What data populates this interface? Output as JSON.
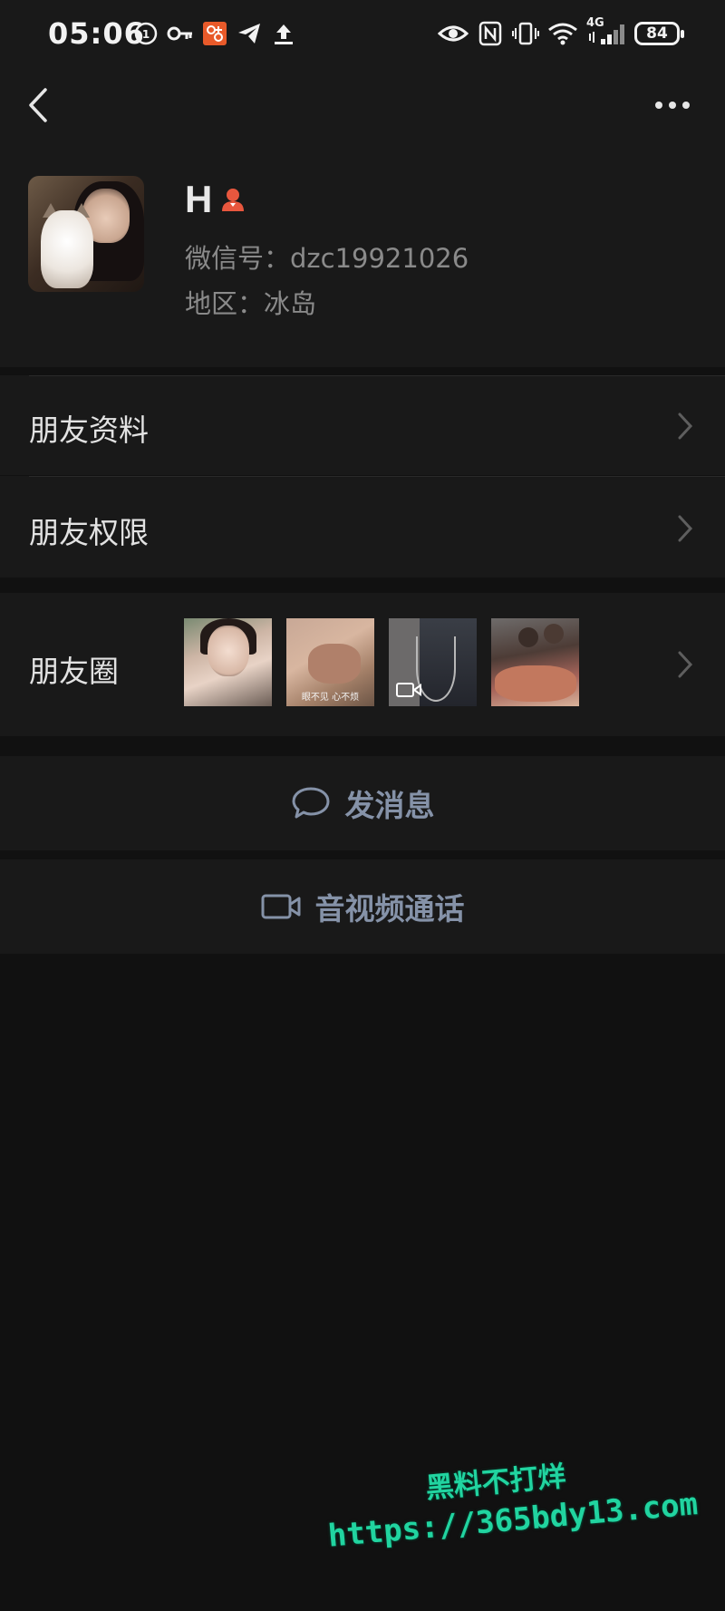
{
  "status_bar": {
    "time": "05:06",
    "network_label": "4G",
    "battery": "84"
  },
  "profile": {
    "name": "H",
    "wechat_id": "微信号：dzc19921026",
    "region": "地区：冰岛"
  },
  "menu": {
    "friend_info": "朋友资料",
    "friend_permissions": "朋友权限",
    "moments": "朋友圈",
    "moments_thumb_caption": "眼不见 心不烦"
  },
  "actions": {
    "send_message": "发消息",
    "video_call": "音视频通话"
  },
  "watermark": {
    "line1": "黑料不打烊",
    "line2": "https://365bdy13.com"
  },
  "colors": {
    "background": "#111111",
    "panel": "#191919",
    "action_text": "#8592a8",
    "gender_badge": "#e8573e",
    "watermark": "#21d4a0"
  }
}
